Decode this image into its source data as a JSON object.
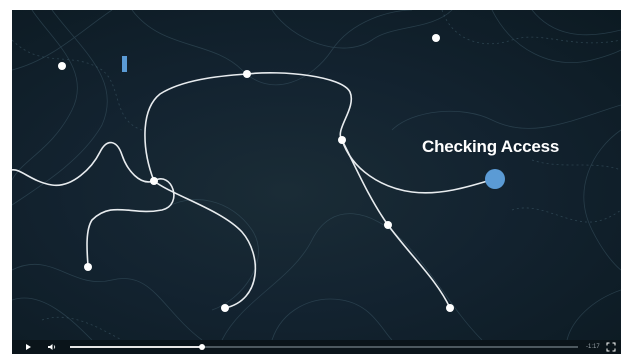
{
  "video": {
    "overlay_title": "Checking Access",
    "accent_color": "#5b9bd5",
    "node_color": "#ffffff",
    "line_color": "#e8ecef"
  },
  "controls": {
    "play_icon": "play-icon",
    "volume_icon": "volume-icon",
    "fullscreen_icon": "fullscreen-icon",
    "time_remaining": "-1:17",
    "progress": 0.26
  }
}
